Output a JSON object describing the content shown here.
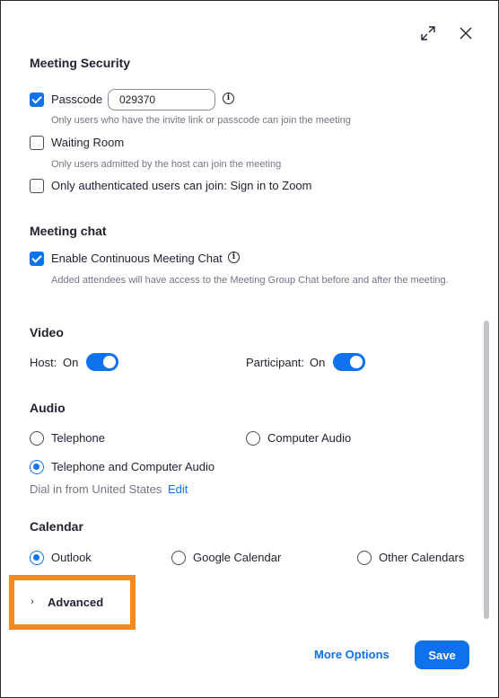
{
  "window": {
    "expand_icon": "expand-icon",
    "close_icon": "close-icon"
  },
  "security": {
    "title": "Meeting Security",
    "passcode": {
      "label": "Passcode",
      "checked": true,
      "value": "029370",
      "hint": "Only users who have the invite link or passcode can join the meeting"
    },
    "waiting_room": {
      "label": "Waiting Room",
      "checked": false,
      "hint": "Only users admitted by the host can join the meeting"
    },
    "authenticated": {
      "label": "Only authenticated users can join: Sign in to Zoom",
      "checked": false
    }
  },
  "chat": {
    "title": "Meeting chat",
    "continuous": {
      "label": "Enable Continuous Meeting Chat",
      "checked": true,
      "hint": "Added attendees will have access to the Meeting Group Chat before and after the meeting."
    }
  },
  "video": {
    "title": "Video",
    "host": {
      "label": "Host:",
      "state": "On",
      "on": true
    },
    "participant": {
      "label": "Participant:",
      "state": "On",
      "on": true
    }
  },
  "audio": {
    "title": "Audio",
    "options": [
      {
        "label": "Telephone",
        "selected": false
      },
      {
        "label": "Computer Audio",
        "selected": false
      },
      {
        "label": "Telephone and Computer Audio",
        "selected": true
      }
    ],
    "dial_in": "Dial in from United States",
    "edit": "Edit"
  },
  "calendar": {
    "title": "Calendar",
    "options": [
      {
        "label": "Outlook",
        "selected": true
      },
      {
        "label": "Google Calendar",
        "selected": false
      },
      {
        "label": "Other Calendars",
        "selected": false
      }
    ]
  },
  "advanced": {
    "label": "Advanced",
    "chevron": "›"
  },
  "footer": {
    "more_options": "More Options",
    "save": "Save"
  },
  "colors": {
    "accent": "#0e72ed",
    "highlight": "#f08a24"
  }
}
